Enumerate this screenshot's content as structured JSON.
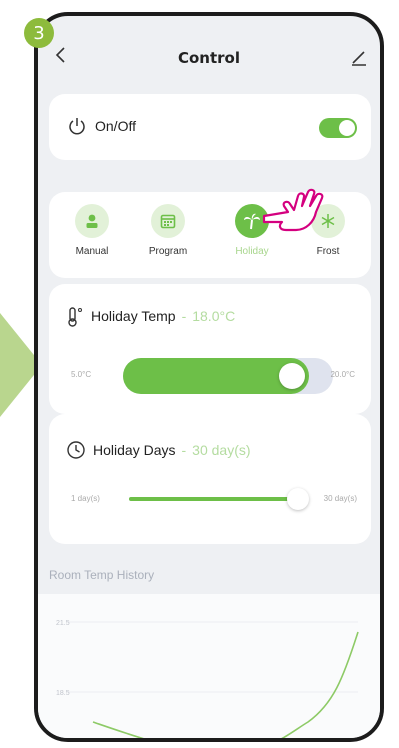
{
  "step_number": "3",
  "header": {
    "title": "Control"
  },
  "power": {
    "label": "On/Off",
    "on": true
  },
  "modes": [
    {
      "label": "Manual",
      "icon": "person-icon",
      "active": false
    },
    {
      "label": "Program",
      "icon": "calendar-icon",
      "active": false
    },
    {
      "label": "Holiday",
      "icon": "palm-tree-icon",
      "active": true
    },
    {
      "label": "Frost",
      "icon": "snowflake-icon",
      "active": false
    }
  ],
  "holiday_temp": {
    "label": "Holiday Temp",
    "separator": "-",
    "value": "18.0°C",
    "min": "5.0°C",
    "max": "20.0°C",
    "level": 0.87
  },
  "holiday_days": {
    "label": "Holiday Days",
    "separator": "-",
    "value": "30 day(s)",
    "min": "1 day(s)",
    "max": "30 day(s)",
    "level": 1.0
  },
  "history": {
    "title": "Room Temp History",
    "y_labels": [
      "21.5",
      "18.5"
    ]
  },
  "colors": {
    "accent": "#6dbf48",
    "accent_light": "#b4dca0",
    "badge": "#8dbb3c"
  }
}
